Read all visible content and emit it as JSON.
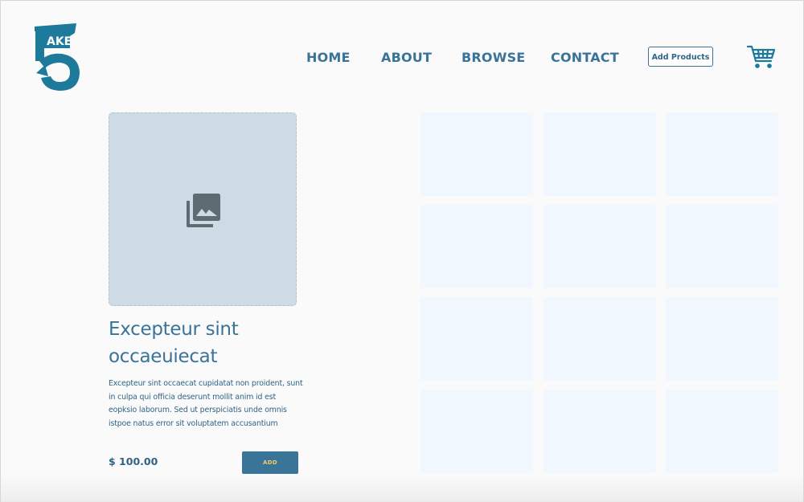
{
  "header": {
    "logo_icon": "take5-logo-icon",
    "logo_text": "AKE",
    "nav": [
      {
        "id": "home",
        "label": "HOME"
      },
      {
        "id": "about",
        "label": "ABOUT"
      },
      {
        "id": "browse",
        "label": "BROWSE"
      },
      {
        "id": "contact",
        "label": "CONTACT"
      }
    ],
    "add_products_label": "Add Products",
    "cart_icon": "shopping-cart-icon"
  },
  "product": {
    "image_icon": "image-placeholder-icon",
    "title_line1": "Excepteur sint",
    "title_line2": "occaeuiecat",
    "description": "Excepteur sint occaecat cupidatat non proident, sunt in culpa qui officia deserunt mollit anim id est eopksio laborum. Sed ut perspiciatis unde omnis istpoe natus error sit voluptatem accusantium",
    "price": "$ 100.00",
    "add_label": "ADD"
  },
  "grid": {
    "rows": 4,
    "columns": 3
  },
  "colors": {
    "primary": "#3a7399",
    "logo": "#1d7a9b",
    "placeholder_bg": "#cddce4",
    "tile_bg": "#f0f7fe",
    "add_text": "#f2c96b"
  }
}
